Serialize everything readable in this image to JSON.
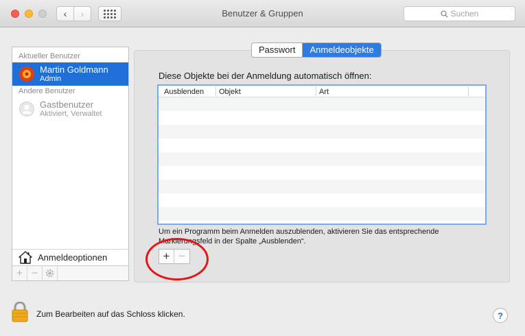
{
  "window": {
    "title": "Benutzer & Gruppen",
    "search_placeholder": "Suchen"
  },
  "sidebar": {
    "current_section": "Aktueller Benutzer",
    "current_user": {
      "name": "Martin Goldmann",
      "role": "Admin"
    },
    "other_section": "Andere Benutzer",
    "other_users": [
      {
        "name": "Gastbenutzer",
        "role": "Aktiviert, Verwaltet"
      }
    ],
    "options_label": "Anmeldeoptionen",
    "tools": {
      "add": "+",
      "remove": "−"
    }
  },
  "tabs": [
    {
      "label": "Passwort",
      "active": false
    },
    {
      "label": "Anmeldeobjekte",
      "active": true
    }
  ],
  "main": {
    "description": "Diese Objekte bei der Anmeldung automatisch öffnen:",
    "columns": [
      "Ausblenden",
      "Objekt",
      "Art"
    ],
    "hint": "Um ein Programm beim Anmelden auszublenden, aktivieren Sie das entsprechende Markierungsfeld in der Spalte „Ausblenden“.",
    "add_label": "+",
    "remove_label": "−"
  },
  "footer": {
    "lock_text": "Zum Bearbeiten auf das Schloss klicken.",
    "help_label": "?"
  },
  "colors": {
    "selection": "#1e6fd7",
    "tab_active": "#2d7ce1",
    "annotation_circle": "#e51515"
  }
}
